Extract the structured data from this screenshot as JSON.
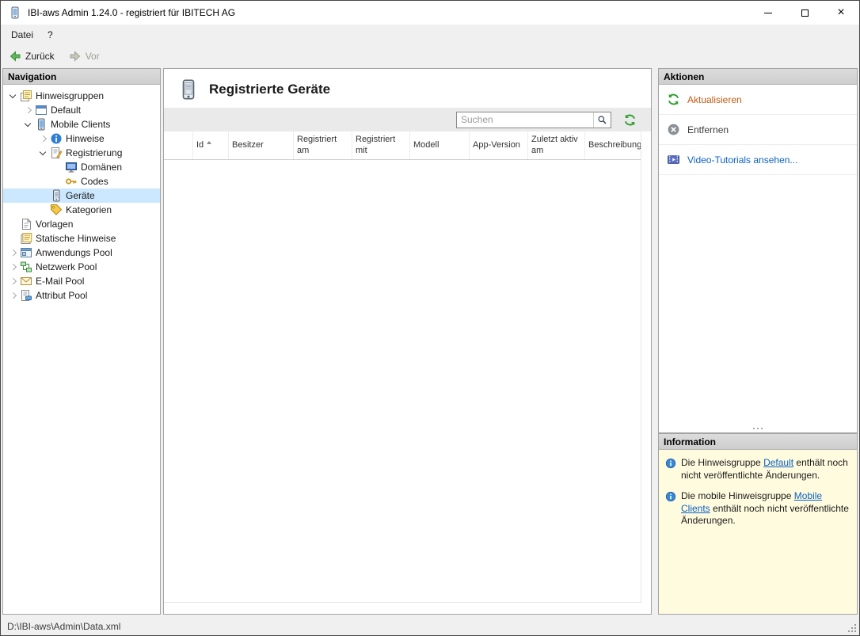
{
  "window": {
    "title": "IBI-aws Admin 1.24.0 - registriert für IBITECH AG"
  },
  "menu": {
    "items": [
      {
        "label": "Datei"
      },
      {
        "label": "?"
      }
    ]
  },
  "toolbar": {
    "back_label": "Zurück",
    "forward_label": "Vor"
  },
  "navigation": {
    "header": "Navigation",
    "tree": [
      {
        "label": "Hinweisgruppen",
        "level": 0,
        "expand": "open",
        "icon": "groups"
      },
      {
        "label": "Default",
        "level": 1,
        "expand": "closed",
        "icon": "window"
      },
      {
        "label": "Mobile Clients",
        "level": 1,
        "expand": "open",
        "icon": "mobile"
      },
      {
        "label": "Hinweise",
        "level": 2,
        "expand": "closed",
        "icon": "hint"
      },
      {
        "label": "Registrierung",
        "level": 2,
        "expand": "open",
        "icon": "registration"
      },
      {
        "label": "Domänen",
        "level": 3,
        "expand": "none",
        "icon": "domain"
      },
      {
        "label": "Codes",
        "level": 3,
        "expand": "none",
        "icon": "key"
      },
      {
        "label": "Geräte",
        "level": 2,
        "expand": "none",
        "icon": "device",
        "selected": true
      },
      {
        "label": "Kategorien",
        "level": 2,
        "expand": "none",
        "icon": "categories"
      },
      {
        "label": "Vorlagen",
        "level": 0,
        "expand": "none",
        "icon": "templates"
      },
      {
        "label": "Statische Hinweise",
        "level": 0,
        "expand": "none",
        "icon": "static"
      },
      {
        "label": "Anwendungs Pool",
        "level": 0,
        "expand": "closed",
        "icon": "appwindow"
      },
      {
        "label": "Netzwerk Pool",
        "level": 0,
        "expand": "closed",
        "icon": "network"
      },
      {
        "label": "E-Mail Pool",
        "level": 0,
        "expand": "closed",
        "icon": "email"
      },
      {
        "label": "Attribut Pool",
        "level": 0,
        "expand": "closed",
        "icon": "attribute"
      }
    ]
  },
  "main": {
    "title": "Registrierte Geräte",
    "search_placeholder": "Suchen",
    "table": {
      "columns": [
        {
          "label": "Id",
          "sorted": true
        },
        {
          "label": "Besitzer"
        },
        {
          "label": "Registriert am"
        },
        {
          "label": "Registriert mit"
        },
        {
          "label": "Modell"
        },
        {
          "label": "App-Version"
        },
        {
          "label": "Zuletzt aktiv am"
        },
        {
          "label": "Beschreibung"
        }
      ],
      "rows": []
    }
  },
  "actions": {
    "header": "Aktionen",
    "items": [
      {
        "label": "Aktualisieren",
        "icon": "refresh",
        "color": "#c55a11"
      },
      {
        "label": "Entfernen",
        "icon": "remove"
      },
      {
        "label": "Video-Tutorials ansehen...",
        "icon": "video",
        "color": "#0b61c4"
      }
    ]
  },
  "information": {
    "header": "Information",
    "items": [
      {
        "prefix": "Die Hinweisgruppe ",
        "link": "Default",
        "suffix": " enthält noch nicht veröffentlichte Änderungen."
      },
      {
        "prefix": "Die mobile Hinweisgruppe ",
        "link": "Mobile Clients",
        "suffix": " enthält noch nicht veröffentlichte Änderungen."
      }
    ]
  },
  "statusbar": {
    "path": "D:\\IBI-aws\\Admin\\Data.xml"
  },
  "colors": {
    "selection": "#cce8ff",
    "action_accent": "#c55a11",
    "link": "#0b61c4",
    "info_background": "#fffbdf",
    "panel_header_background": "#d6d6d6"
  }
}
